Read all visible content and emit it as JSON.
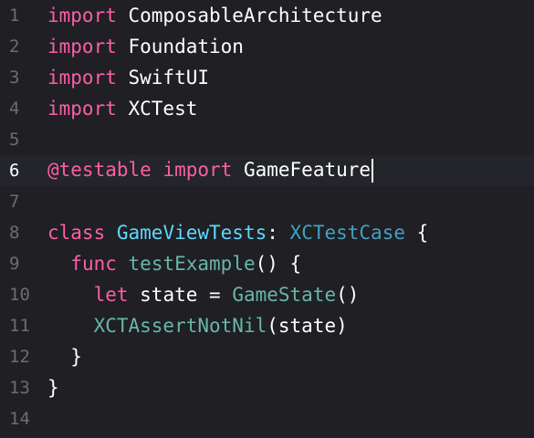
{
  "current_line": 6,
  "colors": {
    "background": "#1f1f24",
    "keyword": "#fc5fa3",
    "declared_type": "#5dd8ff",
    "system_type": "#41a1c0",
    "function": "#67b7a4",
    "text": "#ffffff",
    "gutter": "#6c6c72"
  },
  "lines": [
    {
      "n": "1",
      "tokens": [
        [
          "kw",
          "import"
        ],
        [
          "txt",
          " ComposableArchitecture"
        ]
      ]
    },
    {
      "n": "2",
      "tokens": [
        [
          "kw",
          "import"
        ],
        [
          "txt",
          " Foundation"
        ]
      ]
    },
    {
      "n": "3",
      "tokens": [
        [
          "kw",
          "import"
        ],
        [
          "txt",
          " SwiftUI"
        ]
      ]
    },
    {
      "n": "4",
      "tokens": [
        [
          "kw",
          "import"
        ],
        [
          "txt",
          " XCTest"
        ]
      ]
    },
    {
      "n": "5",
      "tokens": []
    },
    {
      "n": "6",
      "tokens": [
        [
          "attr",
          "@testable"
        ],
        [
          "txt",
          " "
        ],
        [
          "kw",
          "import"
        ],
        [
          "txt",
          " GameFeature"
        ]
      ]
    },
    {
      "n": "7",
      "tokens": []
    },
    {
      "n": "8",
      "tokens": [
        [
          "kw",
          "class"
        ],
        [
          "txt",
          " "
        ],
        [
          "ty",
          "GameViewTests"
        ],
        [
          "txt",
          ": "
        ],
        [
          "sys",
          "XCTestCase"
        ],
        [
          "txt",
          " {"
        ]
      ]
    },
    {
      "n": "9",
      "tokens": [
        [
          "txt",
          "  "
        ],
        [
          "kw",
          "func"
        ],
        [
          "txt",
          " "
        ],
        [
          "fn",
          "testExample"
        ],
        [
          "txt",
          "() {"
        ]
      ]
    },
    {
      "n": "10",
      "tokens": [
        [
          "txt",
          "    "
        ],
        [
          "kw",
          "let"
        ],
        [
          "txt",
          " state = "
        ],
        [
          "fn",
          "GameState"
        ],
        [
          "txt",
          "()"
        ]
      ]
    },
    {
      "n": "11",
      "tokens": [
        [
          "txt",
          "    "
        ],
        [
          "fn",
          "XCTAssertNotNil"
        ],
        [
          "txt",
          "(state)"
        ]
      ]
    },
    {
      "n": "12",
      "tokens": [
        [
          "txt",
          "  }"
        ]
      ]
    },
    {
      "n": "13",
      "tokens": [
        [
          "txt",
          "}"
        ]
      ]
    },
    {
      "n": "14",
      "tokens": []
    }
  ]
}
